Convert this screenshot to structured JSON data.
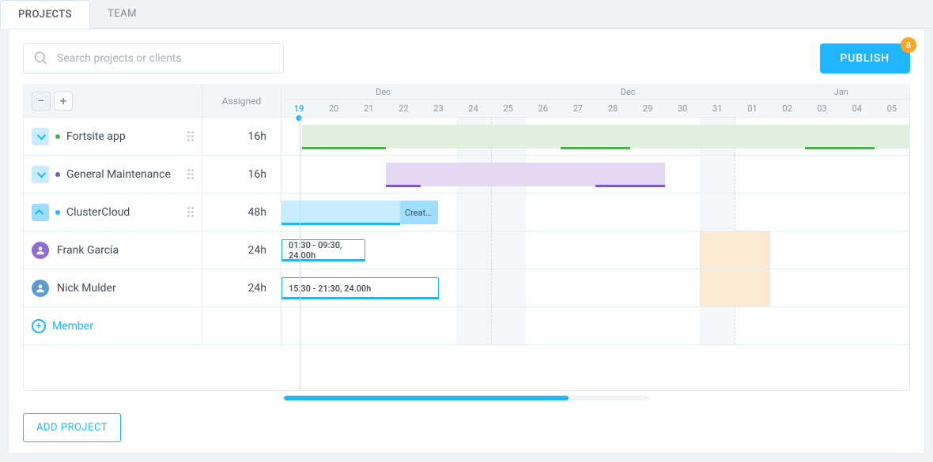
{
  "tabs": {
    "projects": "PROJECTS",
    "team": "TEAM",
    "active": "projects"
  },
  "search": {
    "placeholder": "Search projects or clients"
  },
  "publish": {
    "label": "PUBLISH",
    "badge": "8"
  },
  "header": {
    "assigned_label": "Assigned"
  },
  "timeline": {
    "months": [
      {
        "label": "Dec",
        "left_pct": 15
      },
      {
        "label": "Dec",
        "left_pct": 54
      },
      {
        "label": "Jan",
        "left_pct": 88
      }
    ],
    "days": [
      "19",
      "20",
      "21",
      "22",
      "23",
      "24",
      "25",
      "26",
      "27",
      "28",
      "29",
      "30",
      "31",
      "01",
      "02",
      "03",
      "04",
      "05"
    ],
    "today_index": 0,
    "weekends": [
      {
        "start_idx": 5,
        "span": 2
      },
      {
        "start_idx": 12,
        "span": 1
      }
    ],
    "week_lines": [
      6,
      13
    ]
  },
  "projects": [
    {
      "id": "fortsite",
      "name": "Fortsite app",
      "assigned": "16h",
      "dot": "#4caf50",
      "expanded": false,
      "bar": {
        "start": 0.6,
        "end": 18,
        "fill": "#def1dc"
      },
      "under": [
        {
          "start": 0.6,
          "end": 3,
          "color": "#4caf50"
        },
        {
          "start": 8,
          "end": 10,
          "color": "#4caf50"
        },
        {
          "start": 15,
          "end": 17,
          "color": "#4caf50"
        }
      ]
    },
    {
      "id": "maint",
      "name": "General Maintenance",
      "assigned": "16h",
      "dot": "#7e57c2",
      "expanded": false,
      "bar": {
        "start": 3,
        "end": 11,
        "fill": "#e3d8f3"
      },
      "under": [
        {
          "start": 3,
          "end": 4,
          "color": "#7e57c2"
        },
        {
          "start": 9,
          "end": 11,
          "color": "#7e57c2"
        }
      ]
    },
    {
      "id": "cluster",
      "name": "ClusterCloud",
      "assigned": "48h",
      "dot": "#29b6f6",
      "expanded": true,
      "bar": {
        "start": 0,
        "end": 3.4,
        "fill": "#c7ebff"
      },
      "under": [
        {
          "start": 0,
          "end": 3.4,
          "color": "#1fb6ff"
        }
      ],
      "create": {
        "start": 3.4,
        "end": 4.5,
        "label": "Creat…"
      }
    }
  ],
  "members": [
    {
      "name": "Frank García",
      "assigned": "24h",
      "avatar_bg": "#8e6dd7",
      "shift": {
        "start": 0,
        "end": 2.4,
        "label": "01:30 - 09:30, 24.00h"
      },
      "highlight": {
        "start": 12,
        "end": 14,
        "type": "orange"
      }
    },
    {
      "name": "Nick Mulder",
      "assigned": "24h",
      "avatar_bg": "#5c9bd1",
      "shift": {
        "start": 0,
        "end": 4.5,
        "label": "15:30 - 21:30, 24.00h"
      },
      "highlight": {
        "start": 12,
        "end": 14,
        "type": "orange"
      }
    }
  ],
  "add_member_label": "Member",
  "add_project_label": "ADD PROJECT"
}
